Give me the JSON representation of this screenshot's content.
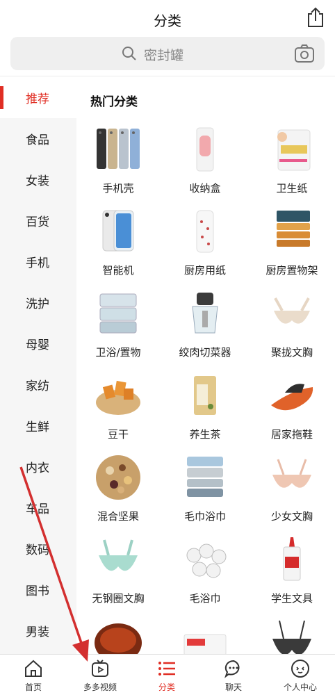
{
  "header": {
    "title": "分类"
  },
  "search": {
    "placeholder": "密封罐"
  },
  "sidebar": {
    "items": [
      {
        "label": "推荐",
        "active": true
      },
      {
        "label": "食品"
      },
      {
        "label": "女装"
      },
      {
        "label": "百货"
      },
      {
        "label": "手机"
      },
      {
        "label": "洗护"
      },
      {
        "label": "母婴"
      },
      {
        "label": "家纺"
      },
      {
        "label": "生鲜"
      },
      {
        "label": "内衣"
      },
      {
        "label": "车品"
      },
      {
        "label": "数码"
      },
      {
        "label": "图书"
      },
      {
        "label": "男装"
      }
    ]
  },
  "main": {
    "section_title": "热门分类",
    "categories": [
      {
        "label": "手机壳",
        "icon": "phone-case-icon"
      },
      {
        "label": "收纳盒",
        "icon": "storage-box-icon"
      },
      {
        "label": "卫生纸",
        "icon": "toilet-paper-icon"
      },
      {
        "label": "智能机",
        "icon": "smartphone-icon"
      },
      {
        "label": "厨房用纸",
        "icon": "kitchen-paper-icon"
      },
      {
        "label": "厨房置物架",
        "icon": "kitchen-rack-icon"
      },
      {
        "label": "卫浴/置物",
        "icon": "bath-storage-icon"
      },
      {
        "label": "绞肉切菜器",
        "icon": "meat-grinder-icon"
      },
      {
        "label": "聚拢文胸",
        "icon": "bra-icon"
      },
      {
        "label": "豆干",
        "icon": "dried-tofu-icon"
      },
      {
        "label": "养生茶",
        "icon": "health-tea-icon"
      },
      {
        "label": "居家拖鞋",
        "icon": "slipper-icon"
      },
      {
        "label": "混合坚果",
        "icon": "mixed-nuts-icon"
      },
      {
        "label": "毛巾浴巾",
        "icon": "towel-icon"
      },
      {
        "label": "少女文胸",
        "icon": "girl-bra-icon"
      },
      {
        "label": "无钢圈文胸",
        "icon": "wireless-bra-icon"
      },
      {
        "label": "毛浴巾",
        "icon": "paper-roll-icon"
      },
      {
        "label": "学生文具",
        "icon": "glue-icon"
      }
    ]
  },
  "tabbar": {
    "items": [
      {
        "label": "首页",
        "icon": "home-icon"
      },
      {
        "label": "多多视频",
        "icon": "tv-icon"
      },
      {
        "label": "分类",
        "icon": "menu-list-icon",
        "active": true
      },
      {
        "label": "聊天",
        "icon": "chat-icon"
      },
      {
        "label": "个人中心",
        "icon": "profile-icon"
      }
    ]
  },
  "colors": {
    "accent": "#e02e24",
    "sidebar_bg": "#f6f6f6",
    "search_bg": "#efefef",
    "arrow": "#d32f2f"
  }
}
